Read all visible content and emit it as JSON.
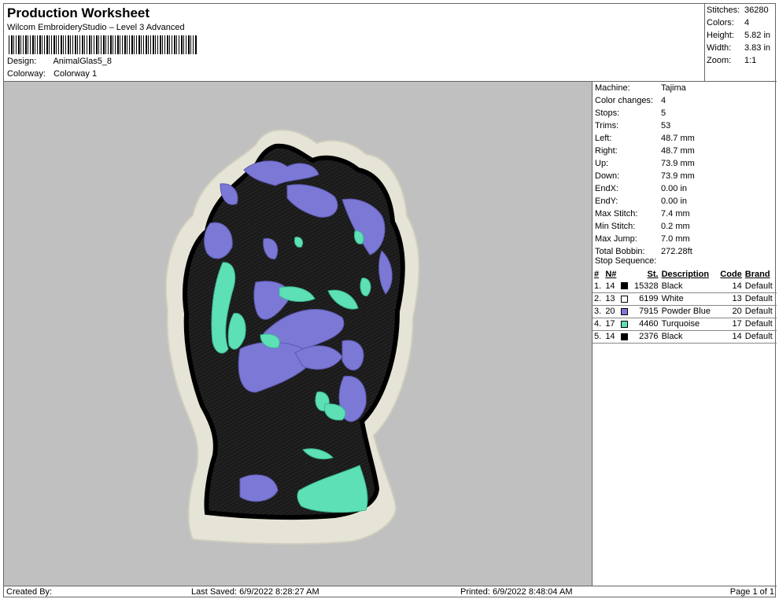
{
  "header": {
    "title": "Production Worksheet",
    "subtitle": "Wilcom EmbroideryStudio – Level 3 Advanced",
    "design_label": "Design:",
    "design_value": "AnimalGlas5_8",
    "colorway_label": "Colorway:",
    "colorway_value": "Colorway 1"
  },
  "summary": [
    {
      "label": "Stitches:",
      "value": "36280"
    },
    {
      "label": "Colors:",
      "value": "4"
    },
    {
      "label": "Height:",
      "value": "5.82 in"
    },
    {
      "label": "Width:",
      "value": "3.83 in"
    },
    {
      "label": "Zoom:",
      "value": "1:1"
    }
  ],
  "machine_info": [
    {
      "label": "Machine:",
      "value": "Tajima"
    },
    {
      "label": "Color changes:",
      "value": "4"
    },
    {
      "label": "Stops:",
      "value": "5"
    },
    {
      "label": "Trims:",
      "value": "53"
    },
    {
      "label": "Left:",
      "value": "48.7 mm"
    },
    {
      "label": "Right:",
      "value": "48.7 mm"
    },
    {
      "label": "Up:",
      "value": "73.9 mm"
    },
    {
      "label": "Down:",
      "value": "73.9 mm"
    },
    {
      "label": "EndX:",
      "value": "0.00 in"
    },
    {
      "label": "EndY:",
      "value": "0.00 in"
    },
    {
      "label": "Max Stitch:",
      "value": "7.4 mm"
    },
    {
      "label": "Min Stitch:",
      "value": "0.2 mm"
    },
    {
      "label": "Max Jump:",
      "value": "7.0 mm"
    },
    {
      "label": "Total Bobbin:",
      "value": "272.28ft"
    }
  ],
  "stop_sequence": {
    "title": "Stop Sequence:",
    "headers": {
      "num": "#",
      "n": "N#",
      "st": "St.",
      "desc": "Description",
      "code": "Code",
      "brand": "Brand"
    },
    "rows": [
      {
        "num": "1.",
        "n": "14",
        "color": "#000000",
        "st": "15328",
        "desc": "Black",
        "code": "14",
        "brand": "Default"
      },
      {
        "num": "2.",
        "n": "13",
        "color": "#ffffff",
        "st": "6199",
        "desc": "White",
        "code": "13",
        "brand": "Default"
      },
      {
        "num": "3.",
        "n": "20",
        "color": "#7b78d6",
        "st": "7915",
        "desc": "Powder Blue",
        "code": "20",
        "brand": "Default"
      },
      {
        "num": "4.",
        "n": "17",
        "color": "#5ee0b6",
        "st": "4460",
        "desc": "Turquoise",
        "code": "17",
        "brand": "Default"
      },
      {
        "num": "5.",
        "n": "14",
        "color": "#000000",
        "st": "2376",
        "desc": "Black",
        "code": "14",
        "brand": "Default"
      }
    ]
  },
  "footer": {
    "created_by": "Created By:",
    "last_saved": "Last Saved: 6/9/2022 8:28:27 AM",
    "printed": "Printed: 6/9/2022 8:48:04 AM",
    "page": "Page 1 of 1"
  },
  "colors": {
    "background": "#c0c0c0",
    "black": "#111111",
    "powder_blue": "#7b78d6",
    "turquoise": "#5ee0b6",
    "patch_border": "#e6e4d6"
  }
}
